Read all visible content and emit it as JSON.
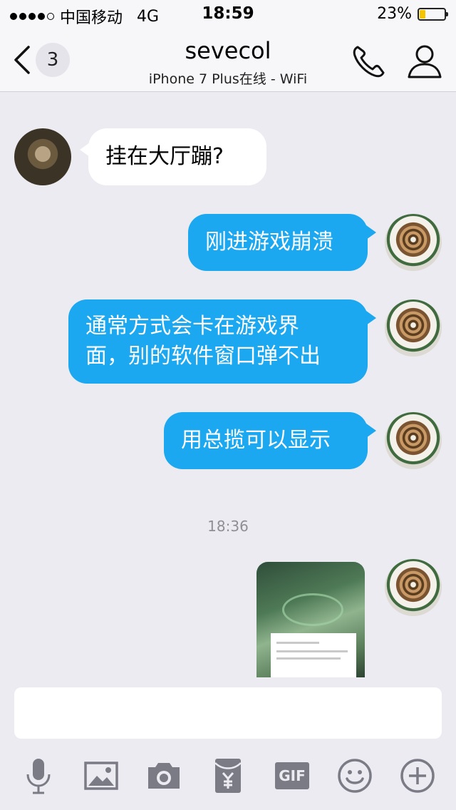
{
  "status_bar": {
    "carrier": "中国移动",
    "network": "4G",
    "time": "18:59",
    "battery_text": "23%",
    "battery_level": 0.23,
    "signal_bars_filled": 4,
    "signal_bars_total": 5
  },
  "nav": {
    "back_badge": "3",
    "title": "sevecol",
    "subtitle": "iPhone 7 Plus在线 - WiFi"
  },
  "messages": [
    {
      "side": "in",
      "text": "挂在大厅蹦?"
    },
    {
      "side": "out",
      "text": "刚进游戏崩溃"
    },
    {
      "side": "out",
      "line1": "通常方式会卡在游戏界",
      "line2": "面，别的软件窗口弹不出"
    },
    {
      "side": "out",
      "text": "用总揽可以显示"
    }
  ],
  "timestamp": "18:36",
  "image_message": {
    "icon": "game-screenshot-image"
  },
  "input": {
    "value": "",
    "placeholder": ""
  },
  "toolbar": {
    "gif_label": "GIF",
    "icons": [
      "microphone-icon",
      "image-icon",
      "camera-icon",
      "red-packet-icon",
      "gif-icon",
      "emoji-icon",
      "plus-icon"
    ]
  },
  "colors": {
    "bubble_out": "#1ba8f0",
    "bubble_in": "#ffffff",
    "background": "#ebebf1",
    "icon_gray": "#7b7b86",
    "battery": "#f5c400"
  }
}
